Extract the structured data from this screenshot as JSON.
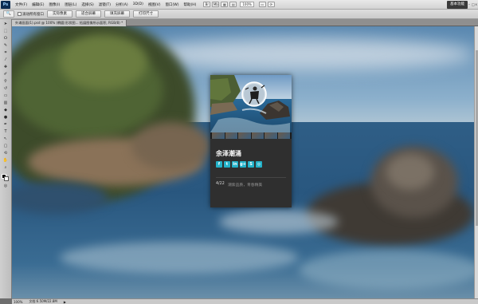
{
  "app": {
    "logo": "Ps",
    "workspace_label": "基本功能"
  },
  "menu": {
    "items": [
      "文件(F)",
      "编辑(E)",
      "图像(I)",
      "图层(L)",
      "选择(S)",
      "滤镜(T)",
      "分析(A)",
      "3D(D)",
      "视图(V)",
      "窗口(W)",
      "帮助(H)"
    ]
  },
  "header": {
    "zoom": "100%"
  },
  "options": {
    "checkbox_label": "滚动所有窗口",
    "buttons": [
      "实际像素",
      "适合屏幕",
      "填充屏幕",
      "打印尺寸"
    ]
  },
  "document": {
    "tab_label": "外滩画面(1).psd @ 100% (椭圆 形状图... 拓展图像所示面积, RGB/8) *"
  },
  "status": {
    "zoom": "100%",
    "doc_info": "文档:6.50M/22.8M"
  },
  "card": {
    "title": "余泽潮涌",
    "social_icons": [
      "facebook-icon",
      "twitter-icon",
      "linkedin-icon",
      "google-plus-icon",
      "skype-icon",
      "dribbble-icon"
    ],
    "social_glyphs": [
      "f",
      "t",
      "in",
      "g+",
      "S",
      "◎"
    ],
    "date": "4/22",
    "text": "潮紫品质，青春精美"
  },
  "colors": {
    "accent": "#23b2c9",
    "card_bg": "#2f2f2f"
  }
}
